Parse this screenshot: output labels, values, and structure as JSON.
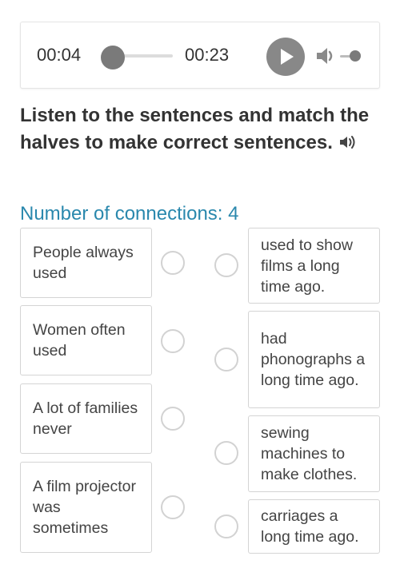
{
  "player": {
    "current_time": "00:04",
    "total_time": "00:23",
    "progress_fraction": 0.17,
    "volume_fraction": 0.8,
    "icons": [
      "play-icon",
      "volume-icon"
    ]
  },
  "instructions": "Listen to the sentences and match the halves to make correct sentences.",
  "connections_label": "Number of connections: 4",
  "left_items": [
    "People always used",
    "Women often used",
    "A lot of families never",
    "A film projector was sometimes"
  ],
  "right_items": [
    "used to show films a long time ago.",
    "had phonographs a long time ago.",
    "sewing machines to make clothes.",
    "carriages a long time ago."
  ],
  "colors": {
    "accent": "#2a88ad",
    "control_grey": "#888888",
    "border": "#d4d4d4"
  }
}
